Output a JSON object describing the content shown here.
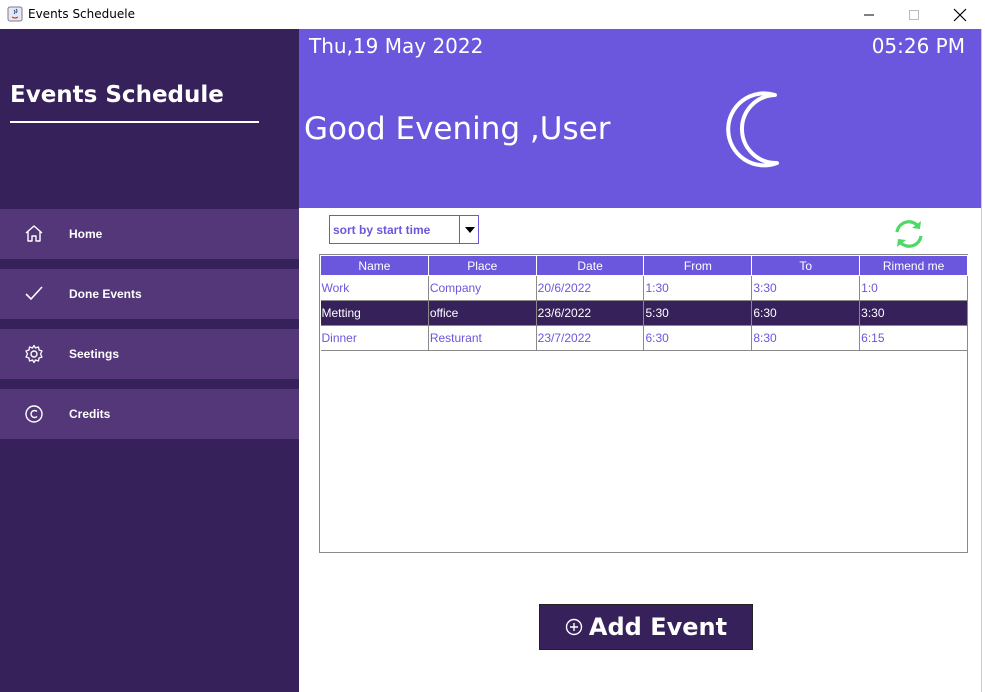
{
  "window": {
    "title": "Events Scheduele"
  },
  "sidebar": {
    "brand": "Events Schedule",
    "items": [
      {
        "label": "Home",
        "icon": "home-icon"
      },
      {
        "label": "Done Events",
        "icon": "check-icon"
      },
      {
        "label": "Seetings",
        "icon": "gear-icon"
      },
      {
        "label": "Credits",
        "icon": "copyright-icon"
      }
    ]
  },
  "header": {
    "date": "Thu,19 May 2022",
    "time": "05:26 PM",
    "greeting": "Good Evening ,User",
    "icon": "moon-icon"
  },
  "sort": {
    "selected": "sort by start time"
  },
  "table": {
    "columns": [
      "Name",
      "Place",
      "Date",
      "From",
      "To",
      "Rimend me"
    ],
    "rows": [
      [
        "Work",
        "Company",
        "20/6/2022",
        "1:30",
        "3:30",
        "1:0"
      ],
      [
        "Metting",
        "office",
        "23/6/2022",
        "5:30",
        "6:30",
        "3:30"
      ],
      [
        "Dinner",
        "Resturant",
        "23/7/2022",
        "6:30",
        "8:30",
        "6:15"
      ]
    ],
    "selected_row": 1
  },
  "add_button": {
    "label": "Add Event"
  },
  "colors": {
    "sidebar": "#36215a",
    "nav_item": "#533778",
    "accent": "#6b57dd",
    "refresh": "#4cd964"
  }
}
